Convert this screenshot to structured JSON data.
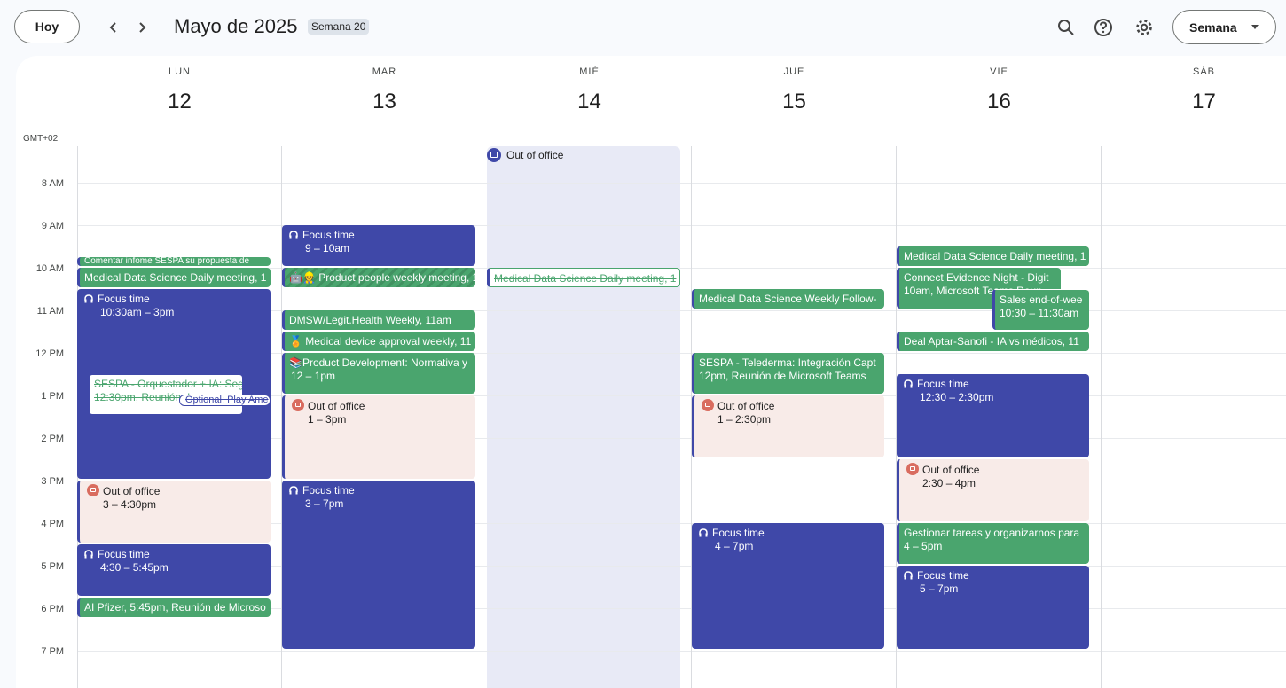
{
  "header": {
    "today_label": "Hoy",
    "title": "Mayo de 2025",
    "week_badge": "Semana 20",
    "view_label": "Semana"
  },
  "timezone": "GMT+02",
  "days": [
    {
      "name": "LUN",
      "num": "12"
    },
    {
      "name": "MAR",
      "num": "13"
    },
    {
      "name": "MIÉ",
      "num": "14"
    },
    {
      "name": "JUE",
      "num": "15"
    },
    {
      "name": "VIE",
      "num": "16"
    },
    {
      "name": "SÁB",
      "num": "17"
    }
  ],
  "hours": [
    "8 AM",
    "9 AM",
    "10 AM",
    "11 AM",
    "12 PM",
    "1 PM",
    "2 PM",
    "3 PM",
    "4 PM",
    "5 PM",
    "6 PM",
    "7 PM"
  ],
  "allday": {
    "title": "Out of office"
  },
  "events": {
    "mon_comentar": {
      "title": "Comentar infome SESPA su propuesta de"
    },
    "mon_mds": {
      "title": "Medical Data Science Daily meeting, 1"
    },
    "mon_focus1": {
      "title": "Focus time",
      "time": "10:30am – 3pm"
    },
    "mon_sespa": {
      "title": "SESPA - Orquestador + IA: Seg",
      "time": "12:30pm, Reunión de"
    },
    "mon_playame": {
      "title": "Optional: Play Ame"
    },
    "mon_ooo": {
      "title": "Out of office",
      "time": "3 – 4:30pm"
    },
    "mon_focus2": {
      "title": "Focus time",
      "time": "4:30 – 5:45pm"
    },
    "mon_pfizer": {
      "title": "AI Pfizer,",
      "time": "5:45pm, Reunión de Microso"
    },
    "tue_focus1": {
      "title": "Focus time",
      "time": "9 – 10am"
    },
    "tue_product": {
      "title": "🤖👷 Product people weekly meeting, 1"
    },
    "tue_dmsw": {
      "title": "DMSW/Legit.Health Weekly,",
      "time": "11am"
    },
    "tue_device": {
      "title": "🏅 Medical device approval weekly, 11"
    },
    "tue_pdev": {
      "title": "📚Product Development: Normativa y",
      "time": "12 – 1pm"
    },
    "tue_ooo": {
      "title": "Out of office",
      "time": "1 – 3pm"
    },
    "tue_focus2": {
      "title": "Focus time",
      "time": "3 – 7pm"
    },
    "wed_mds": {
      "title": "Medical Data Science Daily meeting, 1"
    },
    "thu_weekly": {
      "title": "Medical Data Science Weekly Follow-"
    },
    "thu_sespa": {
      "title": "SESPA - Telederma: Integración Capt",
      "time": "12pm, Reunión de Microsoft Teams"
    },
    "thu_ooo": {
      "title": "Out of office",
      "time": "1 – 2:30pm"
    },
    "thu_focus": {
      "title": "Focus time",
      "time": "4 – 7pm"
    },
    "fri_mds": {
      "title": "Medical Data Science Daily meeting, 1"
    },
    "fri_connect": {
      "title": "Connect Evidence Night - Digit",
      "time": "10am, Microsoft Teams Reun"
    },
    "fri_sales": {
      "title": "Sales end-of-wee",
      "time": "10:30 – 11:30am"
    },
    "fri_deal": {
      "title": "Deal Aptar-Sanofi - IA vs médicos, 11"
    },
    "fri_focus1": {
      "title": "Focus time",
      "time": "12:30 – 2:30pm"
    },
    "fri_ooo": {
      "title": "Out of office",
      "time": "2:30 – 4pm"
    },
    "fri_tareas": {
      "title": "Gestionar tareas y organizarnos para",
      "time": "4 – 5pm"
    },
    "fri_focus2": {
      "title": "Focus time",
      "time": "5 – 7pm"
    }
  },
  "colors": {
    "focus": "#3f48a8",
    "meeting": "#4aa56e",
    "ooo": "#f8ebe8",
    "wed_ooo_bg": "#e8eaf6"
  }
}
